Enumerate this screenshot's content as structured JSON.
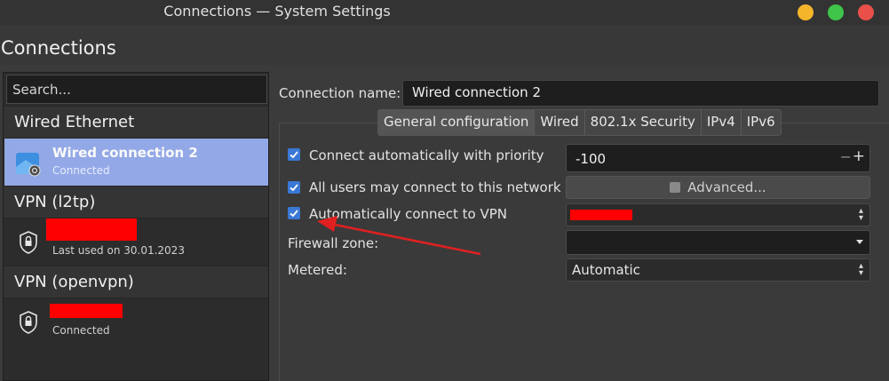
{
  "window": {
    "title": "Connections — System Settings"
  },
  "page": {
    "title": "Connections"
  },
  "sidebar": {
    "search_placeholder": "Search...",
    "groups": [
      {
        "header": "Wired Ethernet",
        "item": {
          "name": "Wired connection 2",
          "status": "Connected"
        }
      },
      {
        "header": "VPN (l2tp)",
        "item": {
          "name": "",
          "status": "Last used on 30.01.2023"
        }
      },
      {
        "header": "VPN (openvpn)",
        "item": {
          "name": "",
          "status": "Connected"
        }
      }
    ]
  },
  "form": {
    "connection_name_label": "Connection name:",
    "connection_name_value": "Wired connection 2",
    "tabs": [
      "General configuration",
      "Wired",
      "802.1x Security",
      "IPv4",
      "IPv6"
    ],
    "auto_connect_label": "Connect automatically with priority",
    "priority_value": "-100",
    "all_users_label": "All users may connect to this network",
    "advanced_button": "Advanced...",
    "auto_vpn_label": "Automatically connect to VPN",
    "firewall_label": "Firewall zone:",
    "metered_label": "Metered:",
    "metered_value": "Automatic"
  },
  "colors": {
    "selection": "#93a8e6",
    "checkbox": "#3a78d6",
    "redaction": "#ff0000",
    "annotation_arrow": "#e02020"
  }
}
